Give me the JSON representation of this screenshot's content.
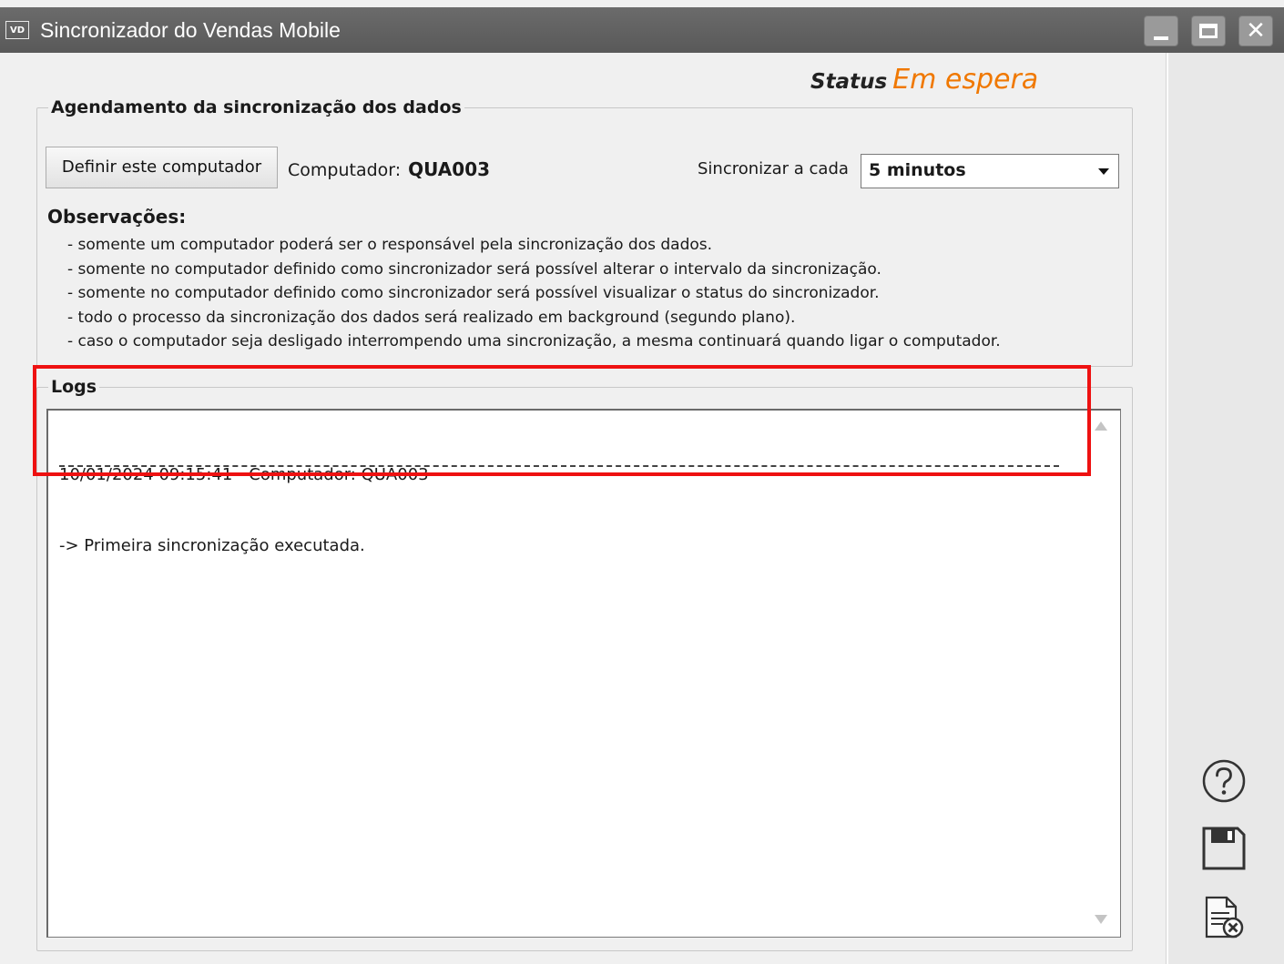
{
  "window": {
    "icon_text": "VD",
    "title": "Sincronizador do Vendas Mobile",
    "controls": {
      "minimize": "minimize",
      "maximize": "maximize",
      "close": "✕"
    }
  },
  "status": {
    "label": "Status",
    "value": "Em espera",
    "value_color": "#f07800"
  },
  "agenda": {
    "legend": "Agendamento da sincronização dos dados",
    "define_button": "Definir este computador",
    "computer_label": "Computador:",
    "computer_value": "QUA003",
    "sync_label": "Sincronizar a cada",
    "sync_value": "5 minutos",
    "observations_title": "Observações:",
    "observations": [
      "- somente um computador poderá ser o responsável pela sincronização dos dados.",
      "- somente no computador definido como sincronizador será possível alterar o intervalo da sincronização.",
      "- somente no computador definido como sincronizador será possível visualizar o status do sincronizador.",
      "- todo o processo da sincronização dos dados será realizado em background (segundo plano).",
      "- caso o computador seja desligado interrompendo uma sincronização, a mesma continuará quando ligar o computador."
    ]
  },
  "logs": {
    "legend": "Logs",
    "entries": [
      "10/01/2024 09:15:41 - Computador: QUA003",
      "-> Primeira sincronização executada."
    ]
  },
  "sidebar": {
    "icons": [
      "help-icon",
      "save-icon",
      "cancel-document-icon"
    ]
  },
  "annotation": {
    "highlight_color": "#ee1111"
  }
}
